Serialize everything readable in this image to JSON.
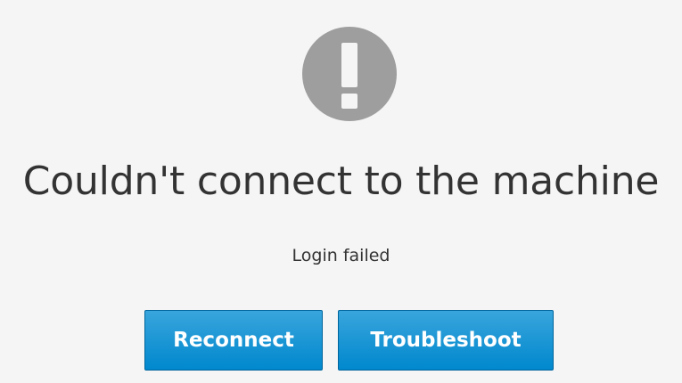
{
  "icons": {
    "alert": "exclamation-circle-icon"
  },
  "message": {
    "title": "Couldn't connect to the machine",
    "detail": "Login failed"
  },
  "actions": {
    "reconnect_label": "Reconnect",
    "troubleshoot_label": "Troubleshoot"
  },
  "colors": {
    "background": "#f5f5f5",
    "icon_gray": "#9e9e9e",
    "button_primary": "#0088ce",
    "text": "#333333"
  }
}
